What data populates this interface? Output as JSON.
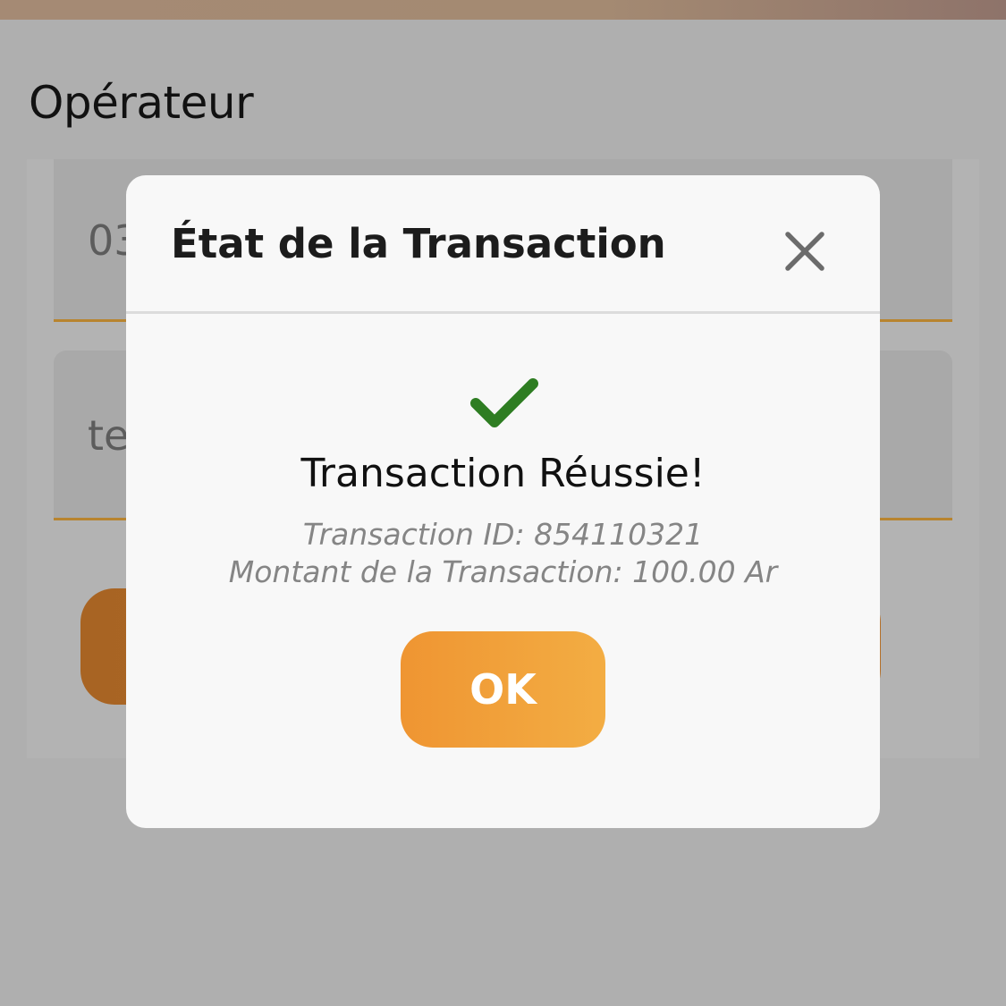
{
  "background": {
    "section_label": "Opérateur",
    "phone_field": {
      "visible_value": "03"
    },
    "type_field": {
      "visible_value": "te"
    }
  },
  "modal": {
    "title": "État de la Transaction",
    "close_icon": "close-icon",
    "status_icon": "checkmark-icon",
    "status_text": "Transaction Réussie!",
    "transaction_id_line": "Transaction ID: 854110321",
    "amount_line": "Montant de la Transaction: 100.00 Ar",
    "ok_label": "OK"
  },
  "colors": {
    "accent": "#f09a36",
    "success": "#2e7d22",
    "field_underline": "#b8842f",
    "overlay": "#afafaf"
  }
}
